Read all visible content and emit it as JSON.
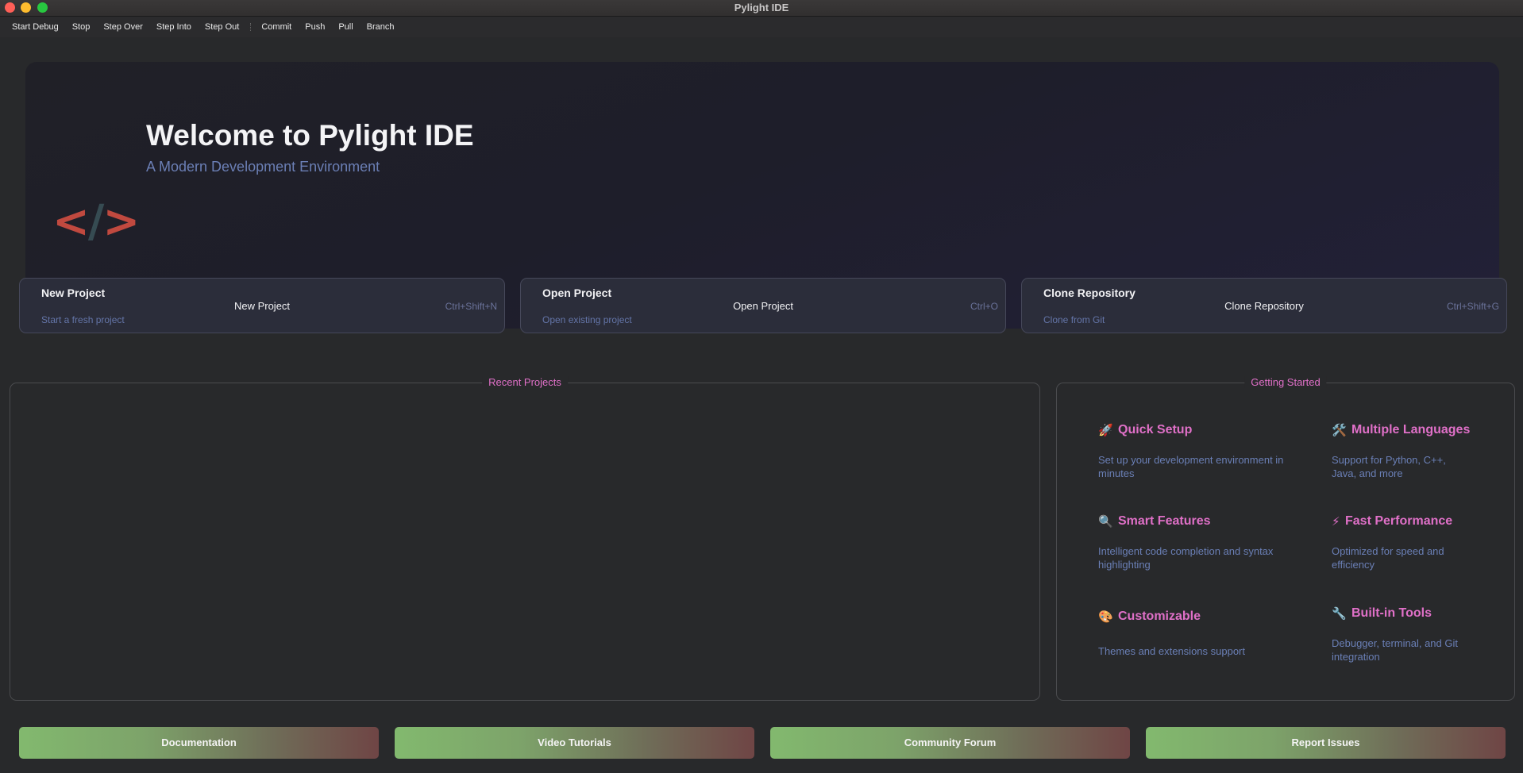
{
  "window": {
    "title": "Pylight IDE"
  },
  "toolbar": {
    "items": [
      "Start Debug",
      "Stop",
      "Step Over",
      "Step Into",
      "Step Out",
      "Commit",
      "Push",
      "Pull",
      "Branch"
    ]
  },
  "hero": {
    "logo": {
      "left": "<",
      "slash": "/",
      "right": ">"
    },
    "title": "Welcome to Pylight IDE",
    "subtitle": "A Modern Development Environment"
  },
  "actions": [
    {
      "title": "New Project",
      "description": "Start a fresh project",
      "label": "New Project",
      "shortcut": "Ctrl+Shift+N"
    },
    {
      "title": "Open Project",
      "description": "Open existing project",
      "label": "Open Project",
      "shortcut": "Ctrl+O"
    },
    {
      "title": "Clone Repository",
      "description": "Clone from Git",
      "label": "Clone Repository",
      "shortcut": "Ctrl+Shift+G"
    }
  ],
  "recent_projects": {
    "title": "Recent Projects"
  },
  "getting_started": {
    "title": "Getting Started",
    "features": [
      {
        "icon": "🚀",
        "title": "Quick Setup",
        "description": "Set up your development environment in minutes"
      },
      {
        "icon": "🛠️",
        "title": "Multiple Languages",
        "description": "Support for Python, C++, Java, and more"
      },
      {
        "icon": "🔍",
        "title": "Smart Features",
        "description": "Intelligent code completion and syntax highlighting"
      },
      {
        "icon": "⚡",
        "title": "Fast Performance",
        "description": "Optimized for speed and efficiency"
      },
      {
        "icon": "🎨",
        "title": "Customizable",
        "description": "Themes and extensions support"
      },
      {
        "icon": "🔧",
        "title": "Built-in Tools",
        "description": "Debugger, terminal, and Git integration"
      }
    ]
  },
  "links": {
    "documentation": "Documentation",
    "video_tutorials": "Video Tutorials",
    "community_forum": "Community Forum",
    "report_issues": "Report Issues"
  },
  "colors": {
    "accent_pink": "#e070c8",
    "subtitle_blue": "#6b7fb5",
    "logo_red": "#c0493f",
    "button_green": "#82b96e",
    "button_red": "#6f4545"
  }
}
